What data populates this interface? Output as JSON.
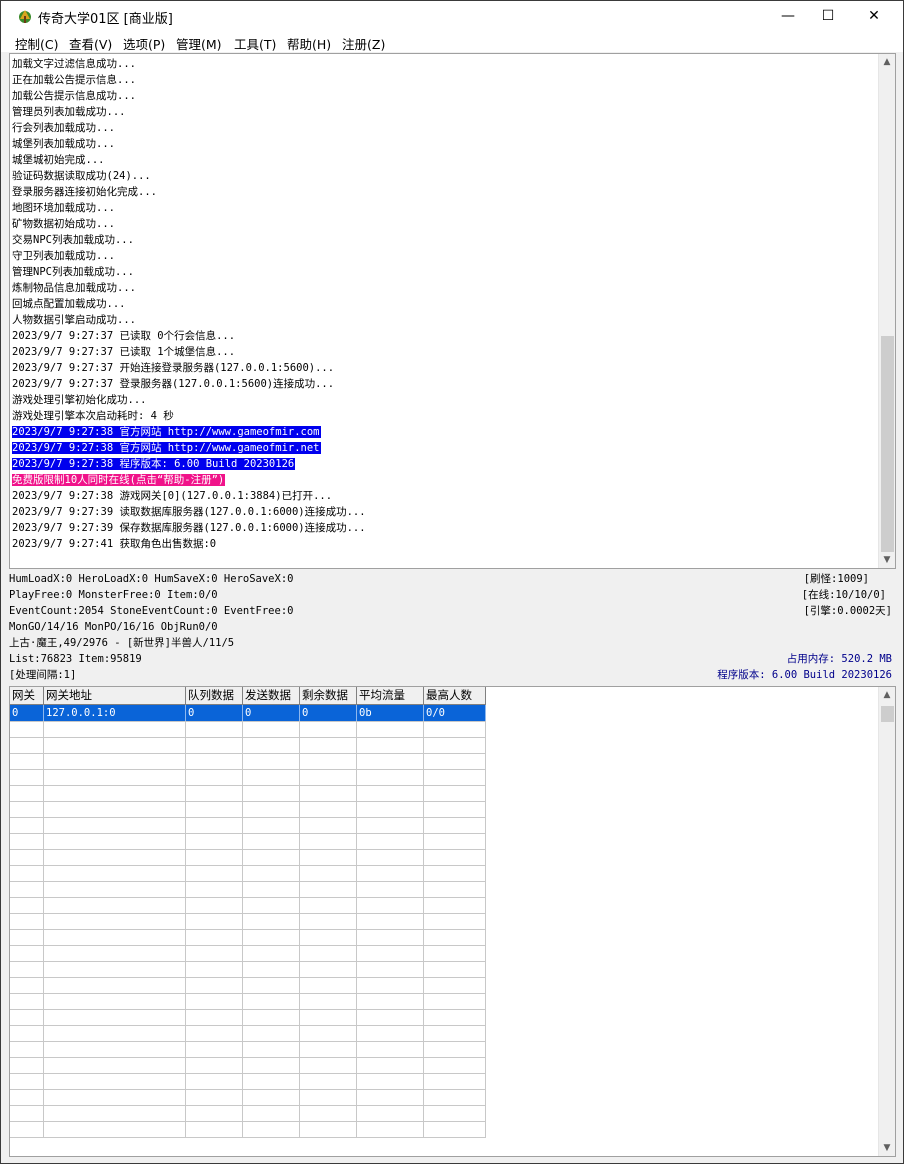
{
  "window": {
    "title": "传奇大学01区 [商业版]",
    "minimize_glyph": "—",
    "maximize_glyph": "☐",
    "close_glyph": "✕"
  },
  "menu": [
    "控制(C)",
    "查看(V)",
    "选项(P)",
    "管理(M)",
    "工具(T)",
    "帮助(H)",
    "注册(Z)"
  ],
  "log": {
    "lines": [
      {
        "text": "加载文字过滤信息成功...",
        "style": "plain"
      },
      {
        "text": "正在加载公告提示信息...",
        "style": "plain"
      },
      {
        "text": "加载公告提示信息成功...",
        "style": "plain"
      },
      {
        "text": "管理员列表加载成功...",
        "style": "plain"
      },
      {
        "text": "行会列表加载成功...",
        "style": "plain"
      },
      {
        "text": "城堡列表加载成功...",
        "style": "plain"
      },
      {
        "text": "城堡城初始完成...",
        "style": "plain"
      },
      {
        "text": "验证码数据读取成功(24)...",
        "style": "plain"
      },
      {
        "text": "登录服务器连接初始化完成...",
        "style": "plain"
      },
      {
        "text": "地图环境加载成功...",
        "style": "plain"
      },
      {
        "text": "矿物数据初始成功...",
        "style": "plain"
      },
      {
        "text": "交易NPC列表加载成功...",
        "style": "plain"
      },
      {
        "text": "守卫列表加载成功...",
        "style": "plain"
      },
      {
        "text": "管理NPC列表加载成功...",
        "style": "plain"
      },
      {
        "text": "炼制物品信息加载成功...",
        "style": "plain"
      },
      {
        "text": "回城点配置加载成功...",
        "style": "plain"
      },
      {
        "text": "人物数据引擎启动成功...",
        "style": "plain"
      },
      {
        "text": "2023/9/7 9:27:37 已读取 0个行会信息...",
        "style": "plain"
      },
      {
        "text": "2023/9/7 9:27:37 已读取 1个城堡信息...",
        "style": "plain"
      },
      {
        "text": "2023/9/7 9:27:37 开始连接登录服务器(127.0.0.1:5600)...",
        "style": "plain"
      },
      {
        "text": "2023/9/7 9:27:37 登录服务器(127.0.0.1:5600)连接成功...",
        "style": "plain"
      },
      {
        "text": "游戏处理引擎初始化成功...",
        "style": "plain"
      },
      {
        "text": "游戏处理引擎本次启动耗时: 4 秒",
        "style": "plain"
      },
      {
        "text": "2023/9/7 9:27:38 官方网站 http://www.gameofmir.com",
        "style": "blue"
      },
      {
        "text": "2023/9/7 9:27:38 官方网站 http://www.gameofmir.net",
        "style": "blue"
      },
      {
        "text": "2023/9/7 9:27:38 程序版本: 6.00 Build 20230126",
        "style": "blue"
      },
      {
        "text": "免费版限制10人同时在线(点击“帮助-注册”)",
        "style": "pink"
      },
      {
        "text": "2023/9/7 9:27:38 游戏网关[0](127.0.0.1:3884)已打开...",
        "style": "plain"
      },
      {
        "text": "2023/9/7 9:27:39 读取数据库服务器(127.0.0.1:6000)连接成功...",
        "style": "plain"
      },
      {
        "text": "2023/9/7 9:27:39 保存数据库服务器(127.0.0.1:6000)连接成功...",
        "style": "plain"
      },
      {
        "text": "2023/9/7 9:27:41 获取角色出售数据:0",
        "style": "plain"
      }
    ]
  },
  "status": {
    "line1": "HumLoadX:0 HeroLoadX:0 HumSaveX:0 HeroSaveX:0",
    "line2": "PlayFree:0 MonsterFree:0 Item:0/0",
    "line3": "EventCount:2054 StoneEventCount:0 EventFree:0",
    "line4": "MonGO/14/16 MonPO/16/16 ObjRun0/0",
    "line5": "上古·魔王,49/2976 - [新世界]半兽人/11/5",
    "line6": "List:76823 Item:95819",
    "line7": "[处理间隔:1]",
    "refresh_monsters": "[刷怪:1009]",
    "online": "[在线:10/10/0]",
    "engine": "[引擎:0.0002天]",
    "memory": "占用内存: 520.2 MB",
    "version": "程序版本: 6.00 Build 20230126"
  },
  "gateway_table": {
    "columns": [
      "网关",
      "网关地址",
      "队列数据",
      "发送数据",
      "剩余数据",
      "平均流量",
      "最高人数"
    ],
    "rows": [
      [
        "0",
        "127.0.0.1:0",
        "0",
        "0",
        "0",
        "0b",
        "0/0"
      ]
    ]
  },
  "colors": {
    "highlight_blue": "#0000ee",
    "highlight_pink": "#f0138a",
    "selection_blue": "#0a64d8",
    "status_blue": "#00008b"
  },
  "icons": {
    "app": "app-icon",
    "scroll_up": "scroll-up-arrow",
    "scroll_down": "scroll-down-arrow"
  }
}
